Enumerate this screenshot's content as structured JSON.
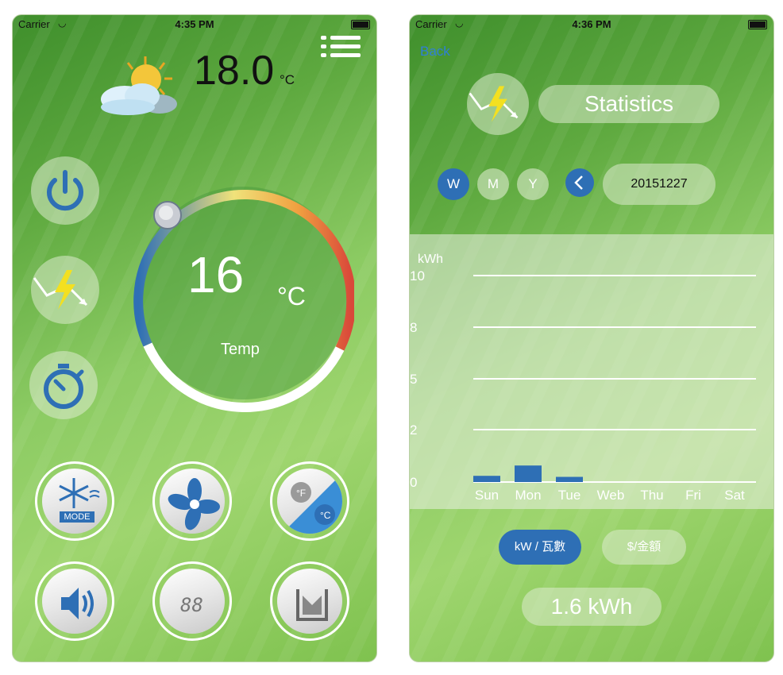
{
  "screen1": {
    "status": {
      "carrier": "Carrier",
      "time": "4:35 PM"
    },
    "outside": {
      "temp": "18.0",
      "unit": "°C"
    },
    "thermostat": {
      "set_temp": "16",
      "unit": "°C",
      "label": "Temp"
    },
    "mode_label": "MODE",
    "display_digits": "88",
    "unit_toggle": {
      "f": "°F",
      "c": "°C"
    }
  },
  "screen2": {
    "status": {
      "carrier": "Carrier",
      "time": "4:36 PM"
    },
    "back": "Back",
    "title": "Statistics",
    "periods": [
      "W",
      "M",
      "Y"
    ],
    "date": "20151227",
    "units": {
      "kw": "kW / 瓦數",
      "money": "$/金額"
    },
    "total": "1.6 kWh",
    "colors": {
      "accent": "#2e6fb5",
      "link": "#2f7fd6"
    }
  },
  "chart_data": {
    "type": "bar",
    "ylabel": "kWh",
    "ytick_labels": [
      "10",
      "8",
      "5",
      "2",
      "0"
    ],
    "categories": [
      "Sun",
      "Mon",
      "Tue",
      "Web",
      "Thu",
      "Fri",
      "Sat"
    ],
    "values": [
      0.3,
      0.8,
      0.25,
      0,
      0,
      0,
      0
    ],
    "ylim": [
      0,
      10
    ],
    "grid": true
  }
}
